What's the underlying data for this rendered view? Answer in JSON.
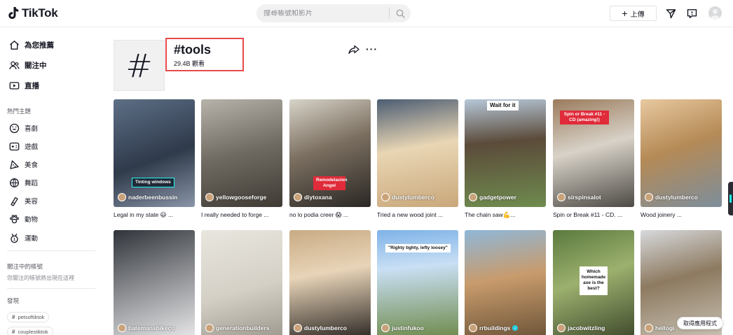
{
  "header": {
    "logo_text": "TikTok",
    "search_placeholder": "搜尋帳號和影片",
    "upload_label": "上傳",
    "icons": [
      "tiktok-logo-icon",
      "search-icon",
      "plus-icon",
      "send-icon",
      "inbox-icon",
      "avatar"
    ]
  },
  "sidebar": {
    "nav": [
      {
        "label": "為您推薦",
        "icon": "home-icon"
      },
      {
        "label": "關注中",
        "icon": "following-icon"
      },
      {
        "label": "直播",
        "icon": "live-icon"
      }
    ],
    "topics_label": "熱門主題",
    "topics": [
      {
        "label": "喜劇",
        "icon": "comedy-icon"
      },
      {
        "label": "遊戲",
        "icon": "gaming-icon"
      },
      {
        "label": "美食",
        "icon": "food-icon"
      },
      {
        "label": "舞蹈",
        "icon": "dance-icon"
      },
      {
        "label": "美容",
        "icon": "beauty-icon"
      },
      {
        "label": "動物",
        "icon": "animals-icon"
      },
      {
        "label": "運動",
        "icon": "sports-icon"
      }
    ],
    "following_label": "關注中的帳號",
    "following_hint": "您關注的帳號將出現在這裡",
    "discover_label": "發現",
    "discover_tags": [
      "petsoftiktok",
      "couplestiktok"
    ]
  },
  "tag_page": {
    "symbol": "#",
    "title": "#tools",
    "views": "29.4B 觀看"
  },
  "videos": [
    {
      "author": "naderbeenbussin",
      "caption": "Legal in my state 😃 ...",
      "overlay": "Tinting windows",
      "verified": false
    },
    {
      "author": "yellowgooseforge",
      "caption": "I really needed to forge ...",
      "overlay": "",
      "verified": false
    },
    {
      "author": "diytoxana",
      "caption": "no lo podia creer 😱 ...",
      "overlay": "Remodelacion Angel",
      "verified": false
    },
    {
      "author": "dustylumberco",
      "caption": "Tried a new wood joint ...",
      "overlay": "",
      "verified": false
    },
    {
      "author": "gadgetpower",
      "caption": "The chain saw💪...",
      "overlay": "Wait for it",
      "verified": false
    },
    {
      "author": "sirspinsalot",
      "caption": "Spin or Break #11 - CD. ...",
      "overlay": "Spin or Break #11 - CD (amazing!)",
      "verified": false
    },
    {
      "author": "dustylumberco",
      "caption": "Wood joinery ...",
      "overlay": "",
      "verified": false
    },
    {
      "author": "batemansbikeco",
      "caption": "",
      "overlay": "",
      "verified": false
    },
    {
      "author": "generationbuilders",
      "caption": "",
      "overlay": "",
      "verified": false
    },
    {
      "author": "dustylumberco",
      "caption": "",
      "overlay": "",
      "verified": false
    },
    {
      "author": "justinfukoo",
      "caption": "",
      "overlay": "\"Righty tighty, lefty loosey\"",
      "verified": false
    },
    {
      "author": "rrbuildings",
      "caption": "",
      "overlay": "",
      "verified": true
    },
    {
      "author": "jacobwitzling",
      "caption": "",
      "overlay": "Which homemade axe is the best?",
      "verified": false
    },
    {
      "author": "hellogi",
      "caption": "",
      "overlay": "",
      "verified": false
    }
  ],
  "get_app_label": "取得應用程式"
}
